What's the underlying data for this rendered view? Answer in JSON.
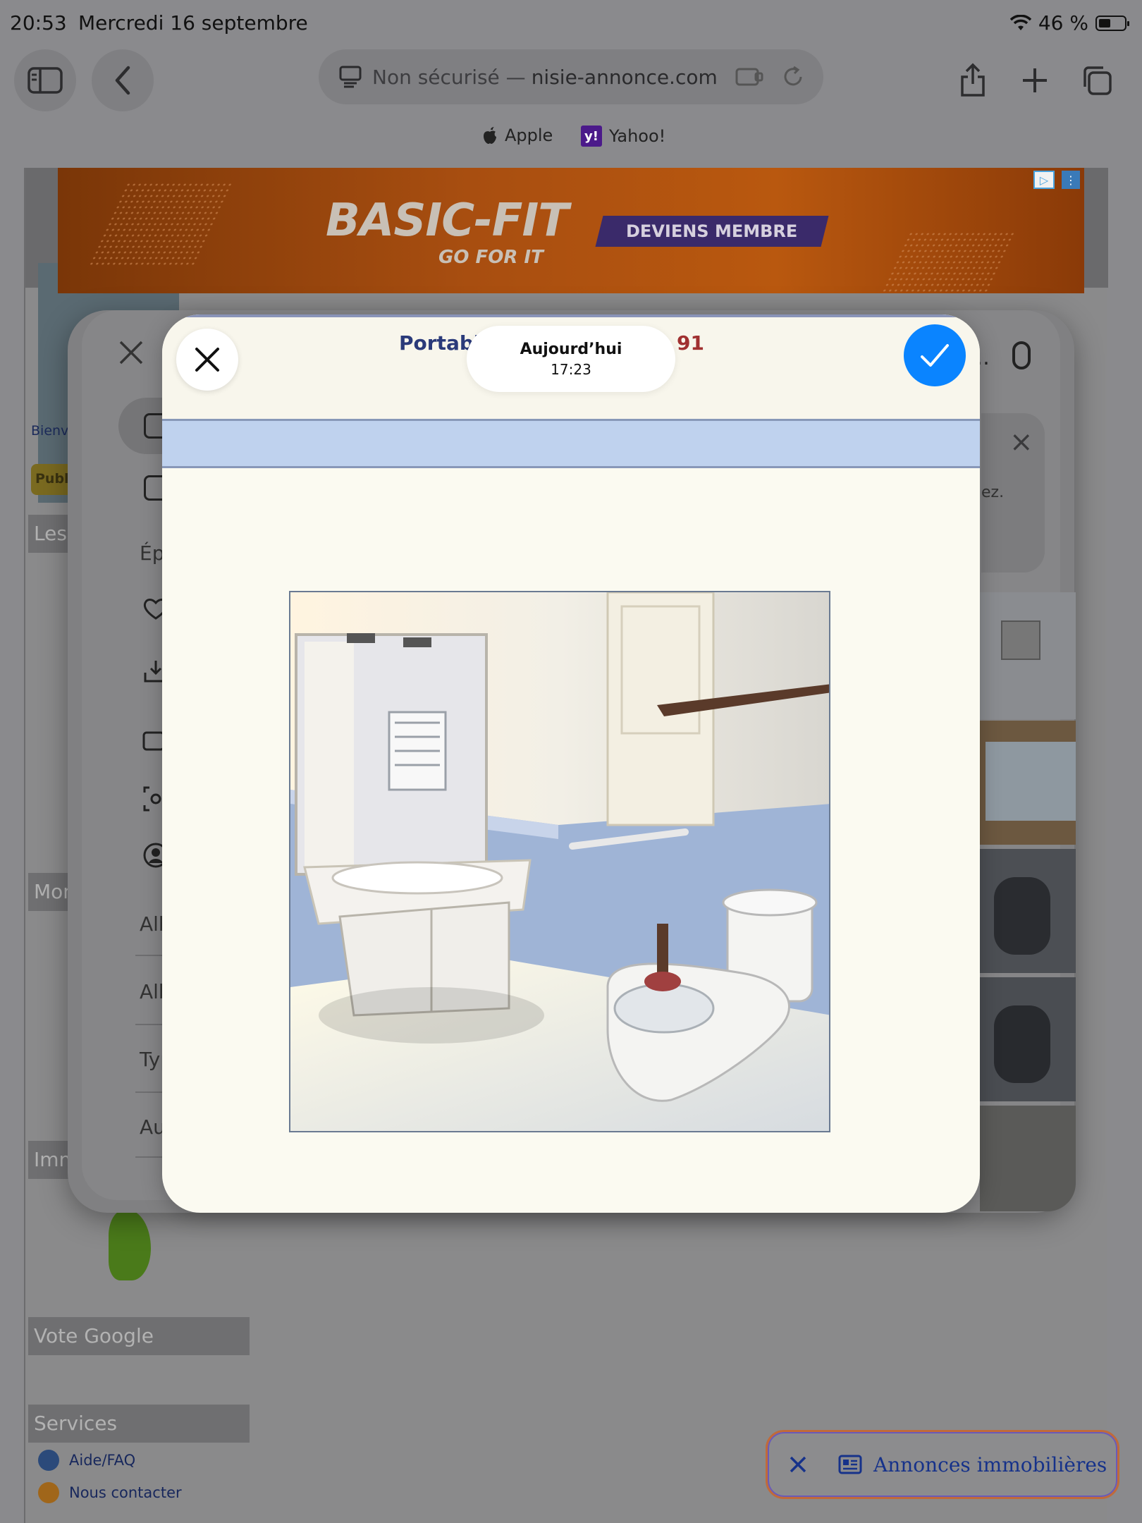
{
  "status_bar": {
    "time": "20:53",
    "date": "Mercredi 16 septembre",
    "battery": "46 %"
  },
  "toolbar": {
    "url_prefix": "Non sécurisé —",
    "url_domain": "nisie-annonce.com"
  },
  "bookmarks": [
    {
      "label": "Apple",
      "icon": "apple-icon"
    },
    {
      "label": "Yahoo!",
      "icon": "yahoo-icon",
      "badge": "y!"
    }
  ],
  "ad": {
    "brand": "BASIC-FIT",
    "slogan": "GO FOR IT",
    "cta": "DEVIENS MEMBRE"
  },
  "page_side": {
    "welcome_fragment": "Bienve",
    "publish_fragment": "Publi",
    "les_fragment": "Les",
    "mon_fragment": "Mon",
    "imm_fragment": "Imm",
    "vote_google": "Vote Google",
    "services": "Services",
    "links": [
      {
        "label": "Aide/FAQ"
      },
      {
        "label": "Nous contacter"
      }
    ]
  },
  "photos_sheet": {
    "menu_epin": "Épin",
    "menu_album1": "Albu",
    "menu_album2": "Albu",
    "menu_type": "Typ",
    "menu_other": "Autr",
    "notice_fragment": "ez."
  },
  "preview": {
    "date_label": "Aujourd’hui",
    "time_label": "17:23",
    "doc_title_left": "Portabl",
    "doc_title_right": "91"
  },
  "bottom_pill": {
    "label": "Annonces immobilières"
  }
}
